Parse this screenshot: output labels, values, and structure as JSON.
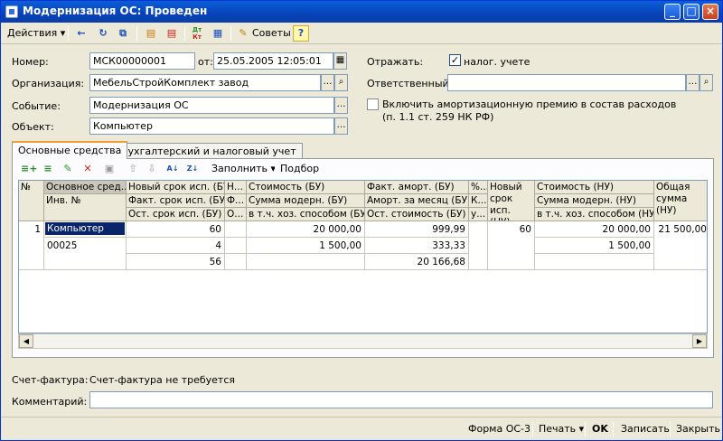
{
  "window": {
    "title": "Модернизация ОС: Проведен"
  },
  "toolbar": {
    "actions_label": "Действия",
    "tips_label": "Советы",
    "dtkt_top": "Дт",
    "dtkt_bottom": "Кт",
    "help_label": "?"
  },
  "form": {
    "number_label": "Номер:",
    "number_value": "МСК00000001",
    "from_label": "от:",
    "date_value": "25.05.2005 12:05:01",
    "org_label": "Организация:",
    "org_value": "МебельСтройКомплект завод",
    "event_label": "Событие:",
    "event_value": "Модернизация ОС",
    "object_label": "Объект:",
    "object_value": "Компьютер",
    "reflect_label": "Отражать:",
    "tax_label": "налог. учете",
    "tax_checked": true,
    "resp_label": "Ответственный:",
    "resp_value": "",
    "bonus_label_1": "Включить амортизационную премию в состав расходов",
    "bonus_label_2": "(п. 1.1 ст. 259 НК РФ)",
    "bonus_checked": false
  },
  "tabs": [
    "Основные средства",
    "Бухгалтерский и налоговый учет"
  ],
  "table_toolbar": {
    "fill_label": "Заполнить",
    "select_label": "Подбор"
  },
  "grid": {
    "headers": {
      "num": "№",
      "asset": "Основное сред...",
      "inv": "Инв. №",
      "new_term_bu": "Новый срок исп. (БУ)",
      "fact_term_bu": "Факт. срок исп. (БУ)",
      "rest_term_bu": "Ост. срок исп. (БУ)",
      "h_col": "Н...",
      "f_col": "Ф...",
      "o_col": "О...",
      "cost_bu": "Стоимость (БУ)",
      "mod_sum_bu": "Сумма модерн. (БУ)",
      "own_bu": "в т.ч. хоз. способом (БУ)",
      "fact_amort_bu": "Факт. аморт. (БУ)",
      "amort_month_bu": "Аморт. за месяц (БУ)",
      "rest_cost_bu": "Ост. стоимость (БУ)",
      "pct": "%...",
      "k_col": "К...",
      "u_col": "у...",
      "new_term_nu": "Новый срок исп. (НУ)",
      "cost_nu": "Стоимость (НУ)",
      "mod_sum_nu": "Сумма модерн. (НУ)",
      "own_nu": "в т.ч. хоз. способом (НУ)",
      "total": "Общая сумма (НУ)"
    },
    "row": {
      "num": "1",
      "asset": "Компьютер",
      "inv": "00025",
      "new_term_bu": "60",
      "fact_term_bu": "4",
      "rest_term_bu": "56",
      "cost_bu": "20 000,00",
      "mod_sum_bu": "1 500,00",
      "fact_amort_bu": "999,99",
      "amort_month_bu": "333,33",
      "rest_cost_bu": "20 166,68",
      "new_term_nu": "60",
      "cost_nu": "20 000,00",
      "mod_sum_nu": "1 500,00",
      "total": "21 500,00"
    }
  },
  "invoice": {
    "label": "Счет-фактура:",
    "value": "Счет-фактура не требуется"
  },
  "comment": {
    "label": "Комментарий:",
    "value": ""
  },
  "bottom": {
    "form_label": "Форма ОС-3",
    "print_label": "Печать",
    "ok_label": "OK",
    "save_label": "Записать",
    "close_label": "Закрыть"
  }
}
